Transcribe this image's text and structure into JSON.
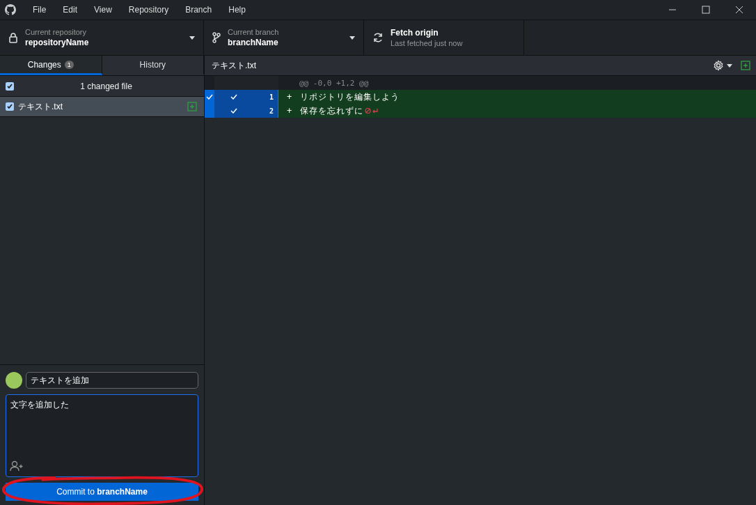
{
  "menu": [
    "File",
    "Edit",
    "View",
    "Repository",
    "Branch",
    "Help"
  ],
  "toolbar": {
    "repository": {
      "label": "Current repository",
      "value": "repositoryName"
    },
    "branch": {
      "label": "Current branch",
      "value": "branchName"
    },
    "fetch": {
      "title": "Fetch origin",
      "subtitle": "Last fetched just now"
    }
  },
  "tabs": [
    {
      "label": "Changes",
      "badge": "1",
      "selected": true
    },
    {
      "label": "History",
      "selected": false
    }
  ],
  "changes": {
    "summary": "1 changed file",
    "all_checked": true,
    "files": [
      {
        "name": "テキスト.txt",
        "checked": true,
        "selected": true
      }
    ]
  },
  "diff": {
    "file": "テキスト.txt",
    "hunk": "@@ -0,0 +1,2 @@",
    "lines": [
      {
        "number": "1",
        "marker": "+",
        "text": "リポジトリを編集しよう",
        "selected": true,
        "focused": true,
        "no_newline": false
      },
      {
        "number": "2",
        "marker": "+",
        "text": "保存を忘れずに",
        "selected": true,
        "focused": false,
        "no_newline": true
      }
    ]
  },
  "commit": {
    "summary": "テキストを追加",
    "description": "文字を追加した",
    "button": "Commit to **branchName**"
  }
}
